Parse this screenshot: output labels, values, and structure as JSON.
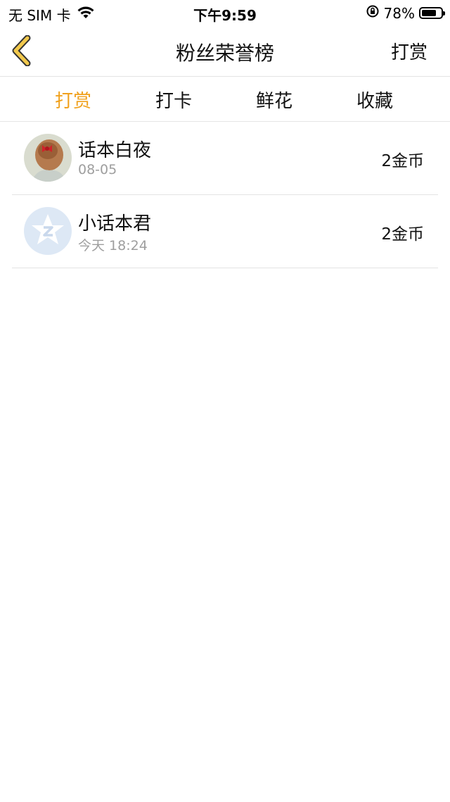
{
  "status_bar": {
    "carrier": "无 SIM 卡",
    "time": "下午9:59",
    "battery_percent": "78%",
    "battery_level": 0.78
  },
  "nav": {
    "title": "粉丝荣誉榜",
    "action_label": "打赏",
    "back_icon": "chevron-left-icon",
    "accent_color": "#f0a11d"
  },
  "tabs": [
    {
      "label": "打赏",
      "active": true
    },
    {
      "label": "打卡",
      "active": false
    },
    {
      "label": "鲜花",
      "active": false
    },
    {
      "label": "收藏",
      "active": false
    }
  ],
  "list": [
    {
      "name": "话本白夜",
      "time": "08-05",
      "amount": "2金币"
    },
    {
      "name": "小话本君",
      "time": "今天 18:24",
      "amount": "2金币"
    }
  ]
}
